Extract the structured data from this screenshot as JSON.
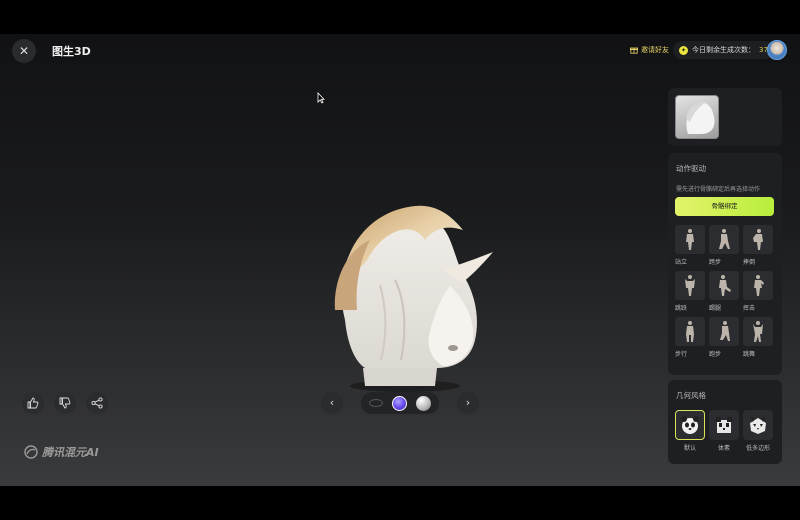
{
  "header": {
    "title": "图生3D",
    "invite_label": "邀请好友",
    "quota_label": "今日剩余生成次数：",
    "quota_value": "37"
  },
  "brand": {
    "logo_text": "腾讯混元AI"
  },
  "action_panel": {
    "title": "动作驱动",
    "hint": "需先进行骨骼绑定后再选择动作",
    "bind_button": "骨骼绑定",
    "motions": [
      "站立",
      "跨步",
      "摔倒",
      "跳跃",
      "踢腿",
      "挥击",
      "步行",
      "跑步",
      "跳舞"
    ]
  },
  "geometry_panel": {
    "title": "几何风格",
    "styles": [
      "默认",
      "体素",
      "低多边形"
    ],
    "selected": "默认"
  },
  "colors": {
    "accent": "#d4e85a",
    "background": "#1a1b1d",
    "panel": "#1e1f22"
  },
  "icons": [
    "close-icon",
    "gift-icon",
    "coin-icon",
    "thumbs-up-icon",
    "thumbs-down-icon",
    "share-icon",
    "chevron-left-icon",
    "chevron-right-icon"
  ]
}
